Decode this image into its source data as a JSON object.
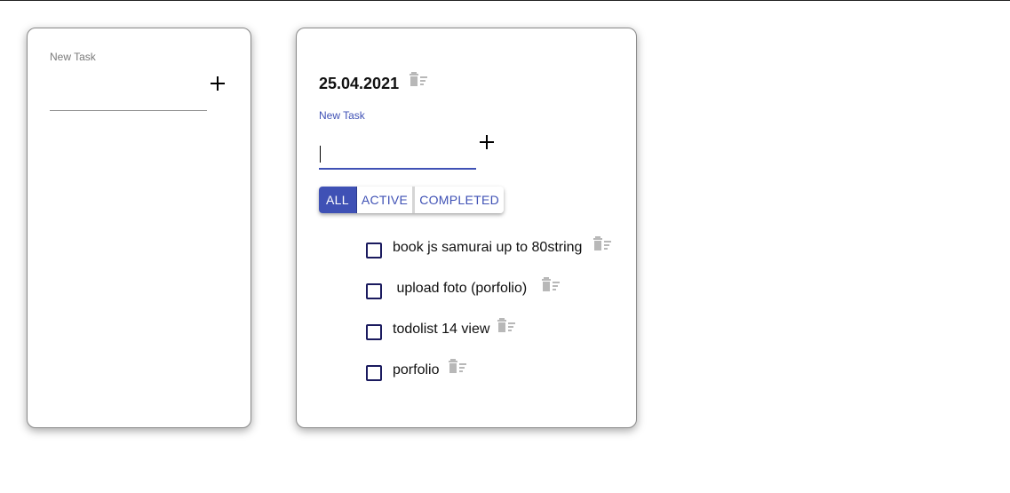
{
  "left_card": {
    "label": "New Task",
    "value": "",
    "add_icon": "plus-icon"
  },
  "right_card": {
    "title": "25.04.2021",
    "title_delete_icon": "trash-icon",
    "label": "New Task",
    "value": "",
    "add_icon": "plus-icon",
    "filters": [
      {
        "label": "ALL",
        "active": true
      },
      {
        "label": "ACTIVE",
        "active": false
      },
      {
        "label": "COMPLETED",
        "active": false
      }
    ],
    "tasks": [
      {
        "text": "book js samurai up to 80string",
        "checked": false
      },
      {
        "text": " upload foto (porfolio)",
        "checked": false
      },
      {
        "text": "todolist 14 view",
        "checked": false
      },
      {
        "text": "porfolio",
        "checked": false
      }
    ]
  },
  "colors": {
    "primary": "#3f51b5",
    "icon_grey": "#b8b8b8"
  }
}
